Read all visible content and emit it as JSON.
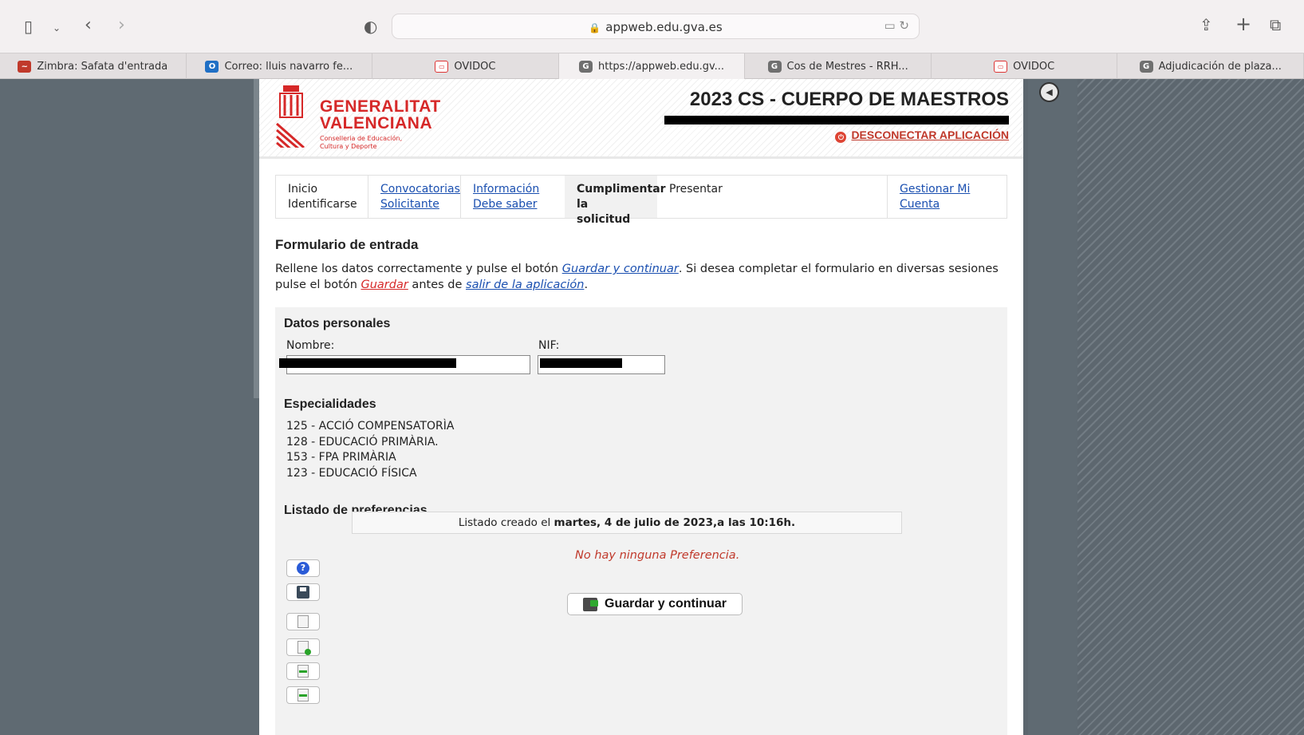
{
  "browser": {
    "url": "appweb.edu.gva.es",
    "tabs": [
      {
        "label": "Zimbra: Safata d'entrada",
        "icon": "zimbra-icon"
      },
      {
        "label": "Correo: lluis navarro fe...",
        "icon": "outlook-icon"
      },
      {
        "label": "OVIDOC",
        "icon": "ovidoc-icon"
      },
      {
        "label": "https://appweb.edu.gv...",
        "icon": "g-icon",
        "active": true
      },
      {
        "label": "Cos de Mestres - RRH...",
        "icon": "g-icon"
      },
      {
        "label": "OVIDOC",
        "icon": "ovidoc-icon"
      },
      {
        "label": "Adjudicación de plaza...",
        "icon": "g-icon"
      }
    ]
  },
  "header": {
    "logo_line1": "GENERALITAT",
    "logo_line2": "VALENCIANA",
    "logo_sub1": "Conselleria de Educación,",
    "logo_sub2": "Cultura y Deporte",
    "app_title": "2023 CS - CUERPO DE MAESTROS",
    "logout_label": "DESCONECTAR APLICACIÓN"
  },
  "steps": [
    {
      "line1": "Inicio",
      "line2": "Identificarse"
    },
    {
      "line1": "Convocatorias",
      "line2": "Solicitante"
    },
    {
      "line1": "Información",
      "line2": "Debe saber"
    },
    {
      "line1": "Cumplimentar",
      "line2": "la solicitud"
    },
    {
      "line1": "Presentar",
      "line2": ""
    },
    {
      "line1": "Gestionar Mi",
      "line2": "Cuenta"
    }
  ],
  "form": {
    "title": "Formulario de entrada",
    "intro_1": "Rellene los datos correctamente y pulse el botón ",
    "intro_link_continue": "Guardar y continuar",
    "intro_2": ". Si desea completar el formulario en diversas sesiones pulse el botón ",
    "intro_link_save": "Guardar",
    "intro_3": " antes de ",
    "intro_link_exit": "salir de la aplicación",
    "intro_4": "."
  },
  "personal": {
    "section_title": "Datos personales",
    "name_label": "Nombre:",
    "nif_label": "NIF:"
  },
  "specialties": {
    "section_title": "Especialidades",
    "items": [
      "125 - ACCIÓ COMPENSATORÌA",
      "128 - EDUCACIÓ PRIMÀRIA.",
      "153 - FPA PRIMÀRIA",
      "123 - EDUCACIÓ FÍSICA"
    ]
  },
  "preferences": {
    "section_title": "Listado de preferencias",
    "created_prefix": "Listado creado el ",
    "created_date": "martes, 4 de julio de 2023,a las 10:16h.",
    "empty_message": "No hay ninguna Preferencia.",
    "save_continue_label": "Guardar y continuar"
  }
}
